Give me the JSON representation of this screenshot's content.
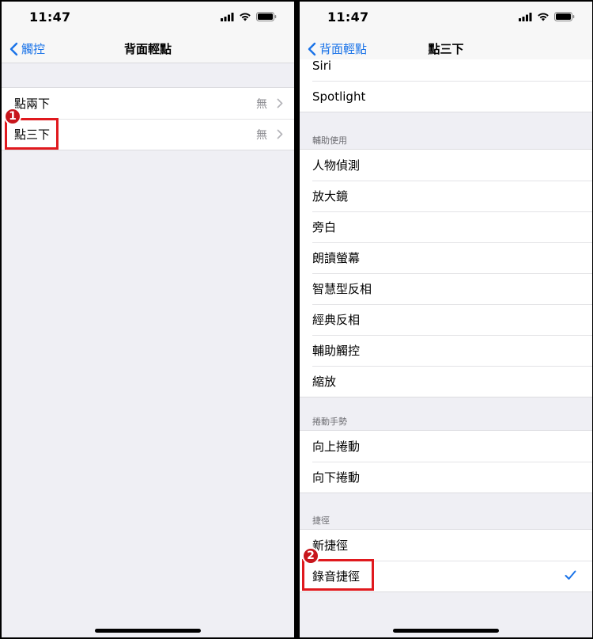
{
  "left": {
    "status": {
      "time": "11:47"
    },
    "nav": {
      "back_label": "觸控",
      "title": "背面輕點"
    },
    "rows": [
      {
        "label": "點兩下",
        "value": "無"
      },
      {
        "label": "點三下",
        "value": "無"
      }
    ],
    "callout": "1"
  },
  "right": {
    "status": {
      "time": "11:47"
    },
    "nav": {
      "back_label": "背面輕點",
      "title": "點三下"
    },
    "top_group": [
      "Siri",
      "Spotlight"
    ],
    "accessibility": {
      "header": "輔助使用",
      "items": [
        "人物偵測",
        "放大鏡",
        "旁白",
        "朗讀螢幕",
        "智慧型反相",
        "經典反相",
        "輔助觸控",
        "縮放"
      ]
    },
    "scroll_gestures": {
      "header": "捲動手勢",
      "items": [
        "向上捲動",
        "向下捲動"
      ]
    },
    "shortcuts": {
      "header": "捷徑",
      "items": [
        "新捷徑",
        "錄音捷徑"
      ],
      "selected": "錄音捷徑"
    },
    "callout": "2"
  },
  "colors": {
    "accent": "#1a73e8",
    "callout": "#e0191e"
  }
}
